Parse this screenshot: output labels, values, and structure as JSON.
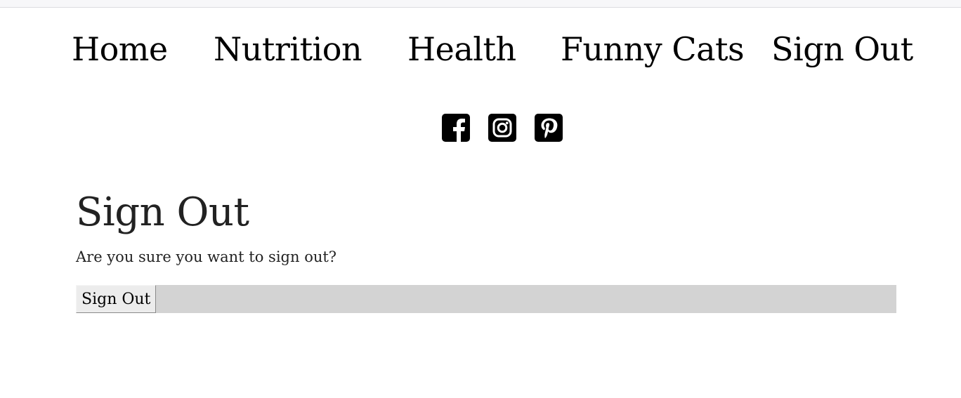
{
  "nav": {
    "items": [
      {
        "label": "Home"
      },
      {
        "label": "Nutrition"
      },
      {
        "label": "Health"
      },
      {
        "label": "Funny Cats"
      },
      {
        "label": "Sign Out"
      }
    ]
  },
  "social": {
    "icons": [
      "facebook-icon",
      "instagram-icon",
      "pinterest-icon"
    ]
  },
  "page": {
    "title": "Sign Out",
    "prompt": "Are you sure you want to sign out?",
    "button_label": "Sign Out"
  },
  "colors": {
    "text": "#222222",
    "form_bar": "#d3d3d3",
    "icon": "#000000"
  }
}
